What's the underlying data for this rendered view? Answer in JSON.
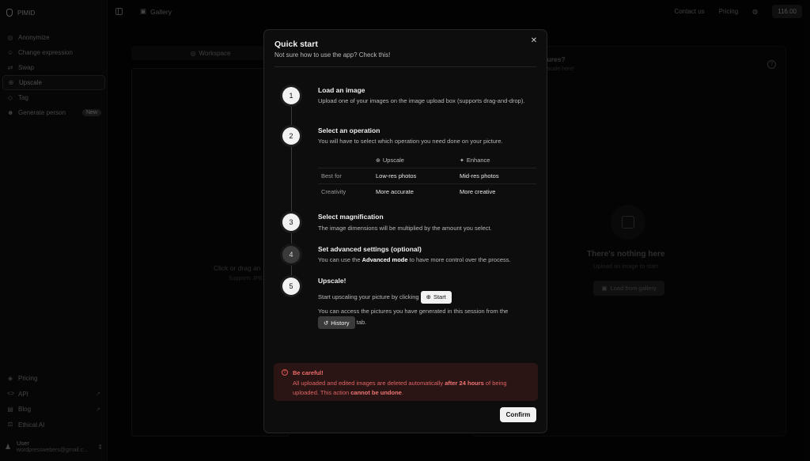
{
  "app": {
    "brand": "PIMID",
    "nav": [
      {
        "label": "Anonymize",
        "icon": "user-icon"
      },
      {
        "label": "Change expression",
        "icon": "smile-icon"
      },
      {
        "label": "Swap",
        "icon": "swap-icon"
      },
      {
        "label": "Upscale",
        "icon": "upscale-icon",
        "active": true
      },
      {
        "label": "Tag",
        "icon": "tag-icon"
      },
      {
        "label": "Generate person",
        "icon": "person-icon",
        "badge": "New"
      }
    ],
    "nav_bottom": [
      {
        "label": "Pricing"
      },
      {
        "label": "API"
      },
      {
        "label": "Blog"
      },
      {
        "label": "Ethical AI"
      }
    ],
    "user": {
      "name": "User",
      "email": "wordpresswebers@gmail.c..."
    },
    "topbar": {
      "gallery": "Gallery",
      "contact": "Contact us",
      "pricing": "Pricing",
      "credits": "116.00"
    },
    "workspace": {
      "tab": "Workspace",
      "upload_title": "Click or drag an",
      "upload_sub": "Supports JPE"
    },
    "pictures": {
      "title": "ctures?",
      "sub": "upscale here!",
      "empty_title": "There's nothing here",
      "empty_sub": "Upload an image to start",
      "load_button": "Load from gallery"
    }
  },
  "modal": {
    "title": "Quick start",
    "subtitle": "Not sure how to use the app? Check this!",
    "steps": [
      {
        "num": "1",
        "title": "Load an image",
        "text": "Upload one of your images on the image upload box (supports drag-and-drop)."
      },
      {
        "num": "2",
        "title": "Select an operation",
        "text": "You will have to select which operation you need done on your picture."
      },
      {
        "num": "3",
        "title": "Select magnification",
        "text": "The image dimensions will be multiplied by the amount you select."
      },
      {
        "num": "4",
        "title": "Set advanced settings (optional)",
        "text_before": "You can use the ",
        "text_bold": "Advanced mode",
        "text_after": " to have more control over the process."
      },
      {
        "num": "5",
        "title": "Upscale!",
        "text_start_before": "Start upscaling your picture by clicking",
        "start_button": "Start",
        "text_history_before": "You can access the pictures you have generated in this session from the",
        "history_button": "History",
        "text_history_after": "tab."
      }
    ],
    "table": {
      "headers": [
        "",
        "Upscale",
        "Enhance"
      ],
      "rows": [
        [
          "Best for",
          "Low-res photos",
          "Mid-res photos"
        ],
        [
          "Creativity",
          "More accurate",
          "More creative"
        ]
      ]
    },
    "warning": {
      "title": "Be careful!",
      "text_1": "All uploaded and edited images are deleted automatically ",
      "text_bold_1": "after 24 hours",
      "text_2": " of being uploaded. This action ",
      "text_bold_2": "cannot be undone",
      "text_3": "."
    },
    "confirm": "Confirm",
    "colors": {
      "accent": "#f2f2f2",
      "warning_bg": "#2a1414",
      "warning_text": "#e06565"
    }
  }
}
